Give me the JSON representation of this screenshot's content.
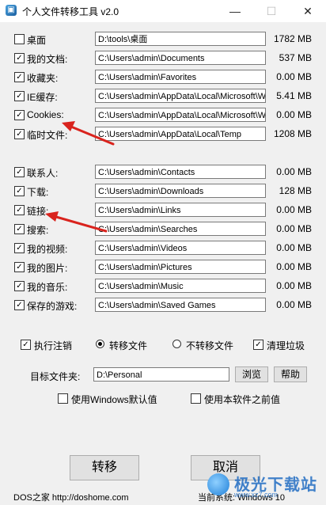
{
  "window": {
    "title": "个人文件转移工具 v2.0",
    "minimize": "—",
    "maximize": "☐",
    "close": "✕"
  },
  "folders_top": [
    {
      "label": "桌面",
      "path": "D:\\tools\\桌面",
      "size": "1782 MB",
      "checked": false
    },
    {
      "label": "我的文档:",
      "path": "C:\\Users\\admin\\Documents",
      "size": "537  MB",
      "checked": true
    },
    {
      "label": "收藏夹:",
      "path": "C:\\Users\\admin\\Favorites",
      "size": "0.00 MB",
      "checked": true
    },
    {
      "label": "IE缓存:",
      "path": "C:\\Users\\admin\\AppData\\Local\\Microsoft\\W",
      "size": "5.41 MB",
      "checked": true
    },
    {
      "label": "Cookies:",
      "path": "C:\\Users\\admin\\AppData\\Local\\Microsoft\\W",
      "size": "0.00 MB",
      "checked": true
    },
    {
      "label": "临时文件:",
      "path": "C:\\Users\\admin\\AppData\\Local\\Temp",
      "size": "1208 MB",
      "checked": true
    }
  ],
  "folders_bottom": [
    {
      "label": "联系人:",
      "path": "C:\\Users\\admin\\Contacts",
      "size": "0.00 MB",
      "checked": true
    },
    {
      "label": "下载:",
      "path": "C:\\Users\\admin\\Downloads",
      "size": "128  MB",
      "checked": true
    },
    {
      "label": "链接:",
      "path": "C:\\Users\\admin\\Links",
      "size": "0.00 MB",
      "checked": true
    },
    {
      "label": "搜索:",
      "path": "C:\\Users\\admin\\Searches",
      "size": "0.00 MB",
      "checked": true
    },
    {
      "label": "我的视频:",
      "path": "C:\\Users\\admin\\Videos",
      "size": "0.00 MB",
      "checked": true
    },
    {
      "label": "我的图片:",
      "path": "C:\\Users\\admin\\Pictures",
      "size": "0.00 MB",
      "checked": true
    },
    {
      "label": "我的音乐:",
      "path": "C:\\Users\\admin\\Music",
      "size": "0.00 MB",
      "checked": true
    },
    {
      "label": "保存的游戏:",
      "path": "C:\\Users\\admin\\Saved Games",
      "size": "0.00 MB",
      "checked": true
    }
  ],
  "options": {
    "run_logoff": {
      "label": "执行注销",
      "checked": true
    },
    "transfer_files": {
      "label": "转移文件",
      "selected": true
    },
    "no_transfer": {
      "label": "不转移文件",
      "selected": false
    },
    "clean_junk": {
      "label": "清理垃圾",
      "checked": true
    }
  },
  "target": {
    "label": "目标文件夹:",
    "value": "D:\\Personal",
    "browse": "浏览",
    "help": "帮助"
  },
  "defaults": {
    "windows_default": {
      "label": "使用Windows默认值",
      "checked": false
    },
    "previous": {
      "label": "使用本软件之前值",
      "checked": false
    }
  },
  "actions": {
    "transfer": "转移",
    "cancel": "取消"
  },
  "footer": {
    "site": "DOS之家 http://doshome.com",
    "system": "当前系统: Windows 10"
  },
  "watermark": {
    "text": "极光下载站",
    "sub": "www.xz7.com"
  },
  "colors": {
    "annotation_arrow": "#d9231d",
    "window_bg": "#f0f0f0"
  }
}
